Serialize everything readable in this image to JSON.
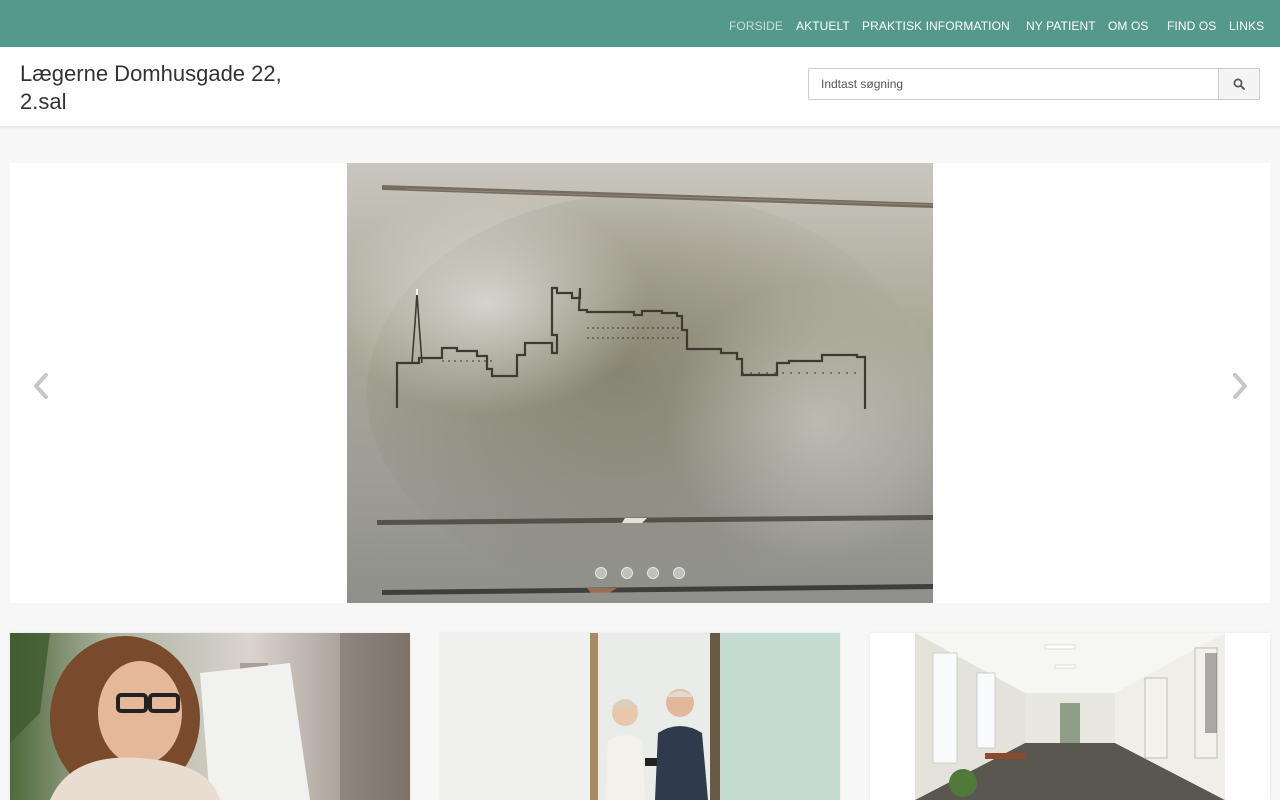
{
  "nav": {
    "items": [
      {
        "label": "FORSIDE",
        "active": true
      },
      {
        "label": "AKTUELT",
        "active": false
      },
      {
        "label": "PRAKTISK INFORMATION",
        "active": false
      },
      {
        "label": "NY PATIENT",
        "active": false
      },
      {
        "label": "OM OS",
        "active": false
      },
      {
        "label": "FIND OS",
        "active": false
      },
      {
        "label": "LINKS",
        "active": false
      }
    ]
  },
  "header": {
    "title": "Lægerne Domhusgade 22, 2.sal"
  },
  "search": {
    "placeholder": "Indtast søgning",
    "icon": "search-icon"
  },
  "carousel": {
    "slide_count": 4,
    "active_slide": 1,
    "prev_icon": "chevron-left-icon",
    "next_icon": "chevron-right-icon"
  },
  "cards": [
    {
      "image": "woman-with-glasses-at-laptop"
    },
    {
      "image": "two-patients-in-waiting-room"
    },
    {
      "image": "clinic-hallway"
    }
  ],
  "colors": {
    "accent": "#54998a",
    "nav_text": "#ffffff",
    "nav_active_text": "#c8ddd8",
    "background": "#f7f7f7"
  }
}
